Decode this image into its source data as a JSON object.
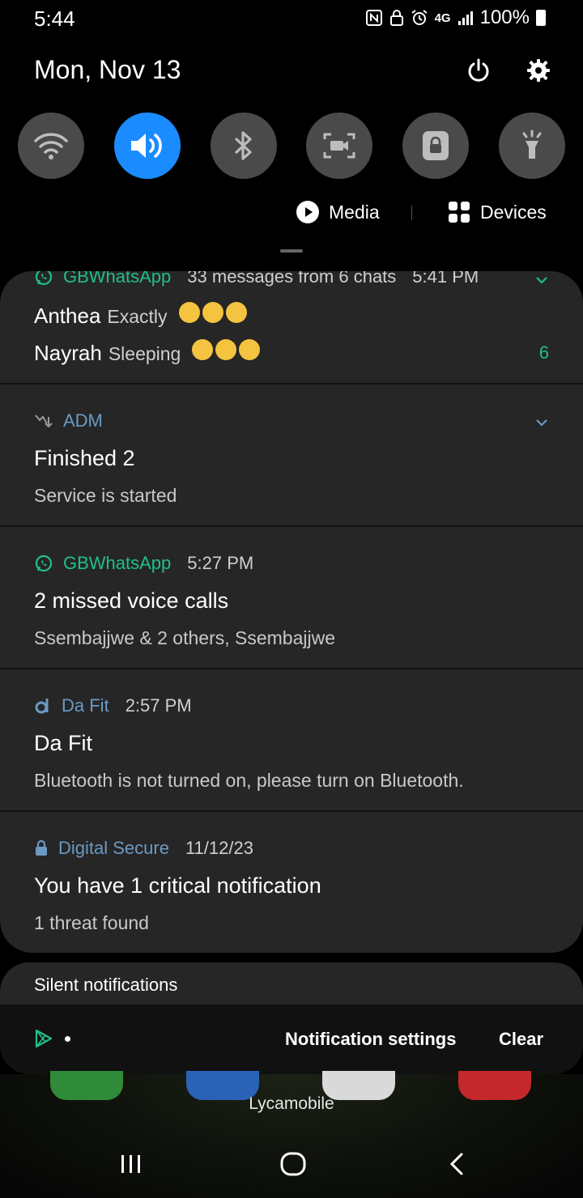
{
  "status_bar": {
    "time": "5:44",
    "network_label": "4G",
    "battery_text": "100%",
    "icons": [
      "nfc-icon",
      "lock-icon",
      "alarm-icon",
      "4g-icon",
      "signal-icon",
      "battery-icon"
    ]
  },
  "header": {
    "date": "Mon, Nov 13",
    "power_icon": "power-icon",
    "settings_icon": "gear-icon"
  },
  "quick_settings": [
    {
      "name": "wifi",
      "icon": "wifi-icon",
      "active": false
    },
    {
      "name": "sound",
      "icon": "volume-icon",
      "active": true
    },
    {
      "name": "bluetooth",
      "icon": "bluetooth-icon",
      "active": false
    },
    {
      "name": "screen-recorder",
      "icon": "screen-record-icon",
      "active": false
    },
    {
      "name": "secure-folder",
      "icon": "lock-icon",
      "active": false
    },
    {
      "name": "flashlight",
      "icon": "flashlight-icon",
      "active": false
    }
  ],
  "media_bar": {
    "media_label": "Media",
    "devices_label": "Devices"
  },
  "notifications": [
    {
      "app": "GBWhatsApp",
      "meta": "33 messages from 6 chats",
      "time": "5:41 PM",
      "messages": [
        {
          "sender": "Anthea",
          "text": "Exactly"
        },
        {
          "sender": "Nayrah",
          "text": "Sleeping"
        }
      ],
      "count": "6"
    },
    {
      "app": "ADM",
      "title": "Finished 2",
      "body": "Service is started"
    },
    {
      "app": "GBWhatsApp",
      "time": "5:27 PM",
      "title": "2 missed voice calls",
      "body": "Ssembajjwe & 2 others, Ssembajjwe"
    },
    {
      "app": "Da Fit",
      "time": "2:57 PM",
      "title": "Da Fit",
      "body": "Bluetooth is not turned on, please turn on Bluetooth."
    },
    {
      "app": "Digital Secure",
      "time": "11/12/23",
      "title": "You have 1 critical notification",
      "body": "1 threat found"
    }
  ],
  "silent_section": {
    "label": "Silent notifications"
  },
  "footer": {
    "settings_label": "Notification settings",
    "clear_label": "Clear"
  },
  "home": {
    "carrier": "Lycamobile"
  },
  "colors": {
    "accent_blue": "#1a8cff",
    "whatsapp_teal": "#1fbf8a",
    "panel_bg": "#262626",
    "tile_bg": "#4a4a4a"
  }
}
